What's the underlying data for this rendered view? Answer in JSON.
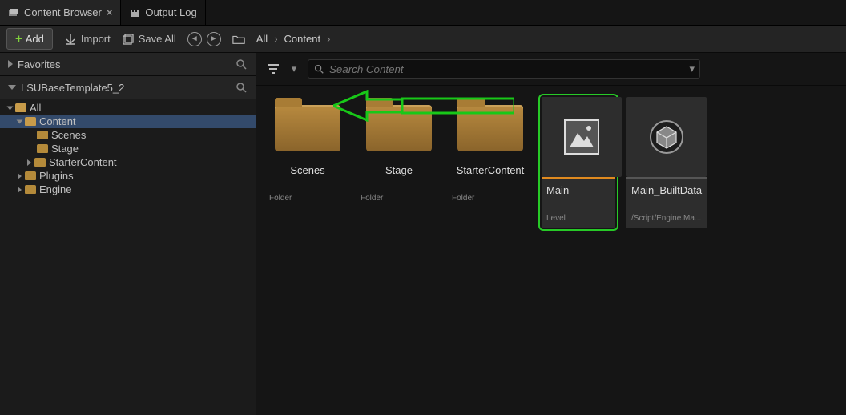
{
  "tabs": [
    {
      "label": "Content Browser",
      "active": true
    },
    {
      "label": "Output Log",
      "active": false
    }
  ],
  "toolbar": {
    "add_label": "Add",
    "import_label": "Import",
    "saveall_label": "Save All"
  },
  "breadcrumb": {
    "root": "All",
    "path1": "Content"
  },
  "sidebar": {
    "favorites_label": "Favorites",
    "project_label": "LSUBaseTemplate5_2",
    "tree": {
      "all": "All",
      "content": "Content",
      "scenes": "Scenes",
      "stage": "Stage",
      "starter": "StarterContent",
      "plugins": "Plugins",
      "engine": "Engine"
    }
  },
  "content": {
    "search_placeholder": "Search Content",
    "items": [
      {
        "name": "Scenes",
        "type": "Folder",
        "kind": "folder"
      },
      {
        "name": "Stage",
        "type": "Folder",
        "kind": "folder"
      },
      {
        "name": "StarterContent",
        "type": "Folder",
        "kind": "folder"
      },
      {
        "name": "Main",
        "type": "Level",
        "kind": "level",
        "selected": true
      },
      {
        "name": "Main_BuiltData",
        "type": "/Script/Engine.Ma...",
        "kind": "data"
      }
    ]
  }
}
